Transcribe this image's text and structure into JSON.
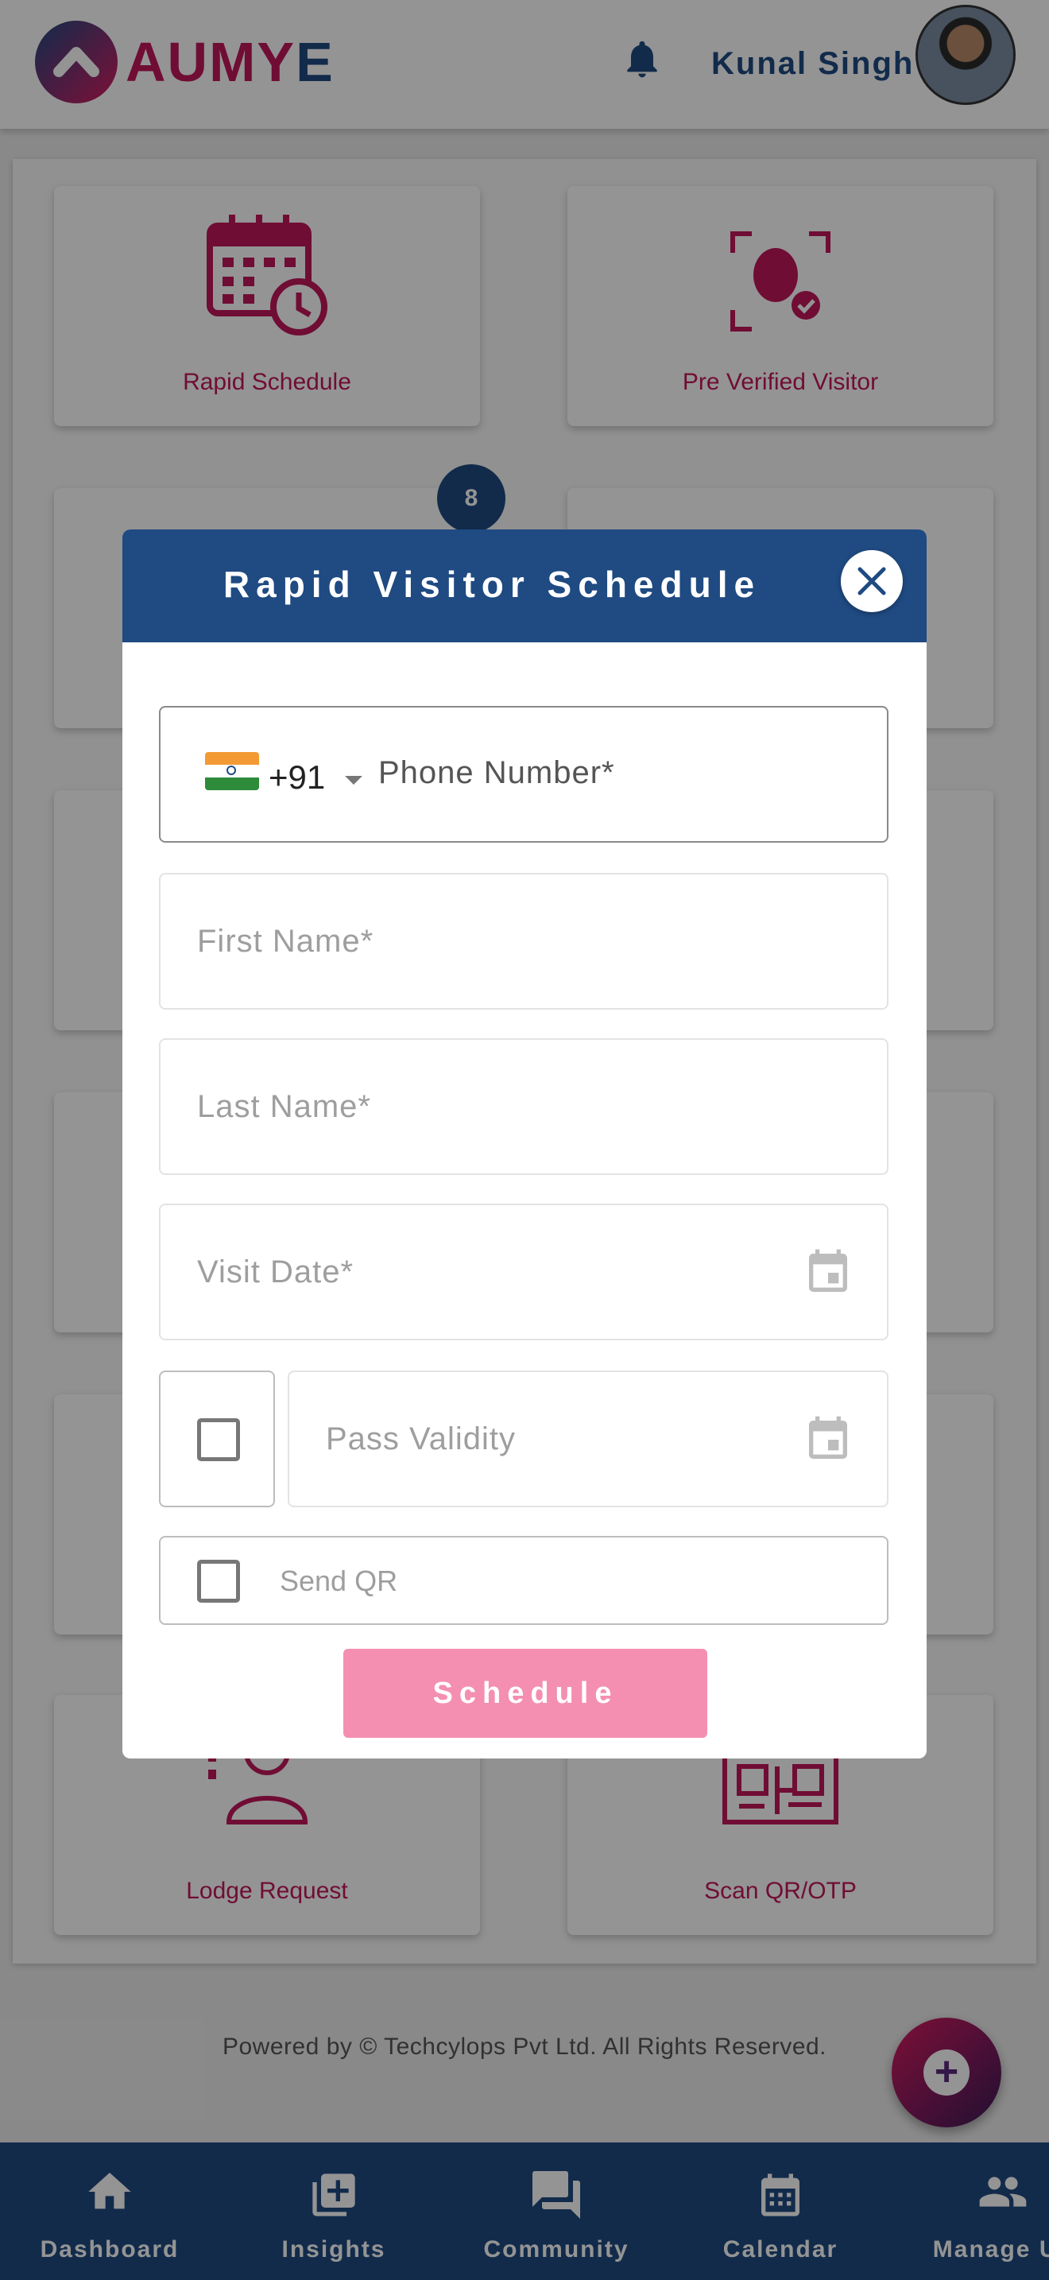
{
  "header": {
    "logo_text_main": "AUMY",
    "logo_text_tail": "E",
    "user_name": "Kunal Singh",
    "icons": [
      "bell-icon",
      "avatar"
    ]
  },
  "tiles": [
    {
      "label": "Rapid Schedule",
      "icon": "calendar-clock-icon"
    },
    {
      "label": "Pre Verified Visitor",
      "icon": "face-verify-icon"
    },
    {
      "label": "Lodge Request",
      "icon": "support-agent-icon"
    },
    {
      "label": "Scan QR/OTP",
      "icon": "qr-scanner-icon"
    }
  ],
  "badge_count": "8",
  "footer": "Powered by © Techcylops Pvt Ltd. All Rights Reserved.",
  "fab_icon": "add-circle-icon",
  "bottom_nav": [
    {
      "label": "Dashboard",
      "icon": "home-icon"
    },
    {
      "label": "Insights",
      "icon": "insights-icon"
    },
    {
      "label": "Community",
      "icon": "forum-icon"
    },
    {
      "label": "Calendar",
      "icon": "calendar-icon"
    },
    {
      "label": "Manage Us",
      "icon": "people-icon"
    }
  ],
  "modal": {
    "title": "Rapid Visitor Schedule",
    "country_code": "+91",
    "phone_placeholder": "Phone Number*",
    "first_name_placeholder": "First Name*",
    "last_name_placeholder": "Last Name*",
    "visit_date_placeholder": "Visit Date*",
    "pass_validity_placeholder": "Pass Validity",
    "send_qr_label": "Send QR",
    "schedule_label": "Schedule"
  },
  "colors": {
    "brand_blue": "#1f4a82",
    "brand_pink": "#c2185b",
    "button_pink": "#f48fb1"
  }
}
